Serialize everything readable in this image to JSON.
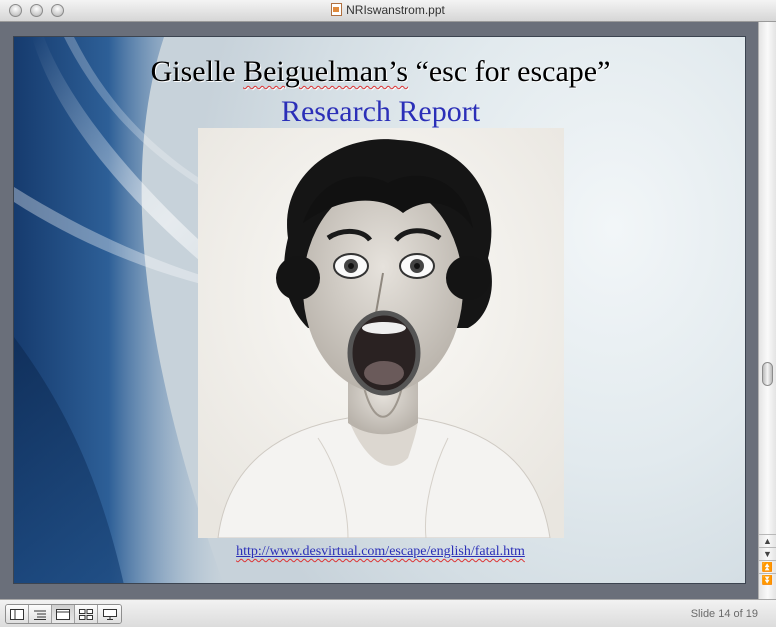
{
  "window": {
    "title": "NRIswanstrom.ppt"
  },
  "slide": {
    "title_prefix": "Giselle ",
    "title_name": "Beiguelman’s",
    "title_suffix": " “esc for escape”",
    "subtitle": "Research Report",
    "link_text": "http://www.desvirtual.com/escape/english/fatal.htm",
    "image_description_icon": "screaming-woman-photo"
  },
  "statusbar": {
    "slide_counter": "Slide 14 of 19",
    "view_buttons": [
      "normal-view-icon",
      "outline-view-icon",
      "slide-view-icon",
      "slide-sorter-icon",
      "slide-show-icon"
    ]
  },
  "colors": {
    "subtitle": "#2b2fb8",
    "link": "#2b2fb8",
    "frame": "#6a6f7a"
  }
}
